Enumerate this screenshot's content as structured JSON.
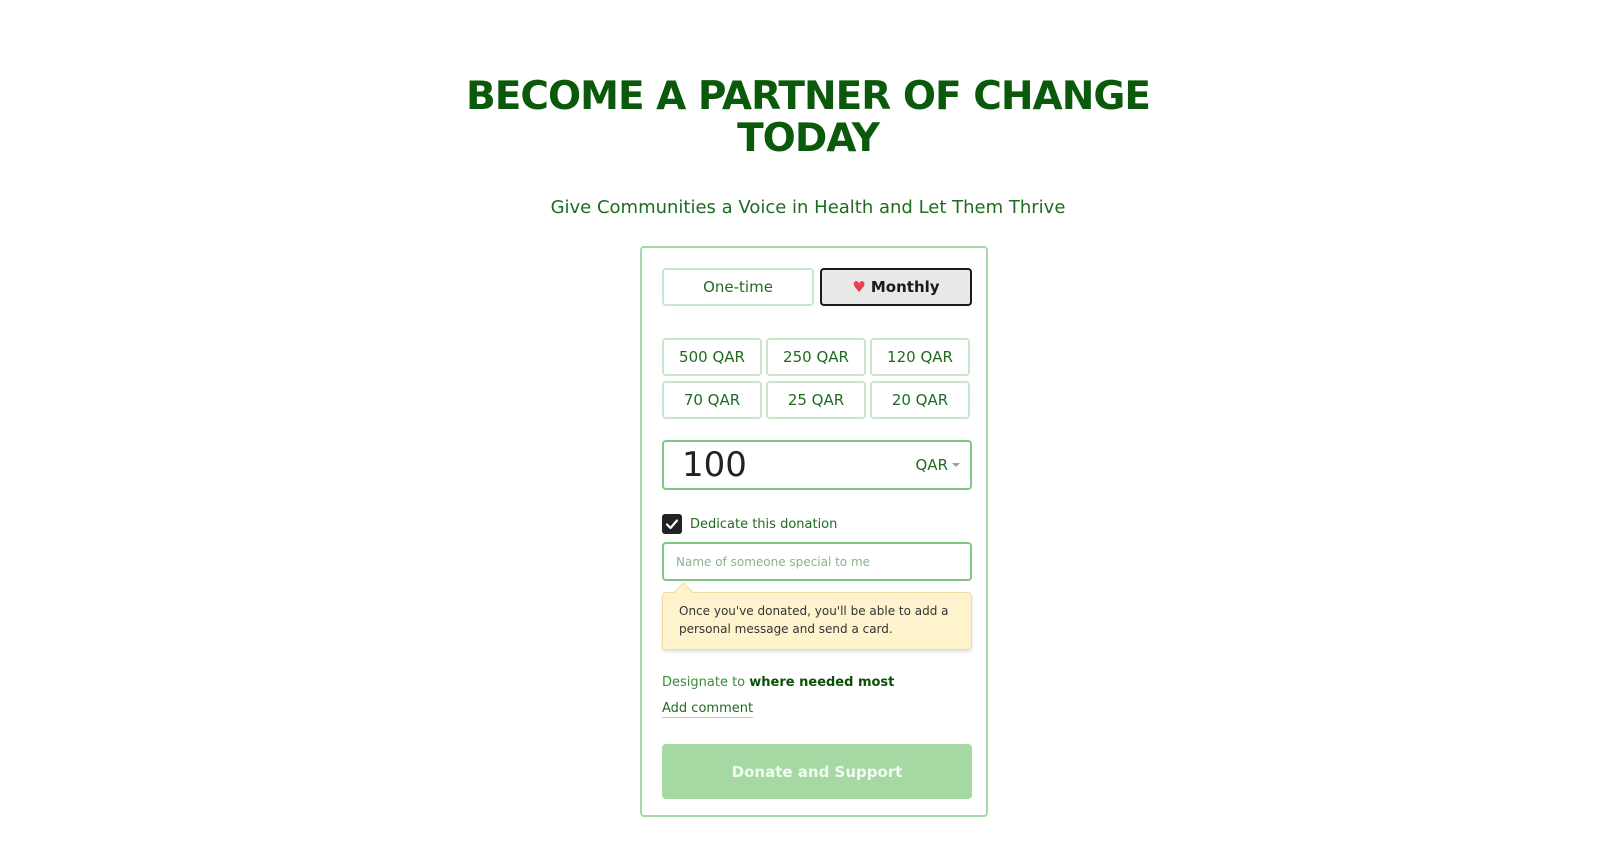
{
  "header": {
    "title_line1": "BECOME A PARTNER OF CHANGE",
    "title_line2": "TODAY",
    "subtitle": "Give Communities a Voice in Health and Let Them Thrive"
  },
  "frequency": {
    "one_time_label": "One-time",
    "monthly_label": "Monthly",
    "selected": "Monthly"
  },
  "amounts": [
    "500 QAR",
    "250 QAR",
    "120 QAR",
    "70 QAR",
    "25 QAR",
    "20 QAR"
  ],
  "custom_amount": {
    "value": "100",
    "currency": "QAR"
  },
  "dedication": {
    "checked": true,
    "label": "Dedicate this donation",
    "placeholder": "Name of someone special to me",
    "value": "",
    "notice": "Once you've donated, you'll be able to add a personal message and send a card."
  },
  "designation": {
    "prefix": "Designate to",
    "target": "where needed most"
  },
  "add_comment_label": "Add comment",
  "donate_button_label": "Donate and Support",
  "colors": {
    "brand_green": "#0b5a0b",
    "border_green": "#a5d8a7",
    "donate_button": "#a5d8a2",
    "heart": "#ef3b4f",
    "notice_bg": "#fff3cd"
  },
  "icons": {
    "monthly": "heart-icon",
    "checkbox": "checkmark-icon",
    "currency_select": "caret-down-icon"
  }
}
